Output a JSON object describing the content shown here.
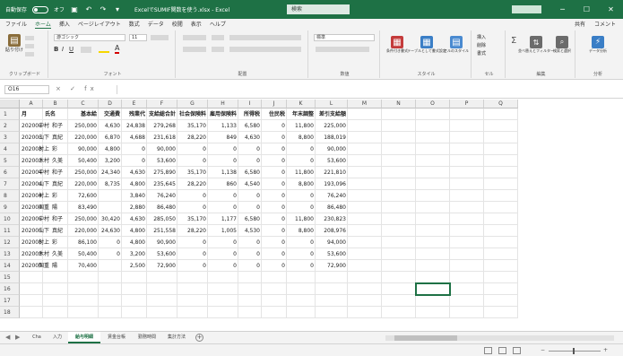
{
  "titlebar": {
    "autosave_label": "自動保存",
    "autosave_state": "オフ",
    "title": "ExcelでSUMIF関数を使う.xlsx - Excel",
    "search_placeholder": "検索",
    "minimize": "─",
    "restore": "☐",
    "close": "✕"
  },
  "menu": {
    "tabs": [
      "ファイル",
      "ホーム",
      "挿入",
      "ページレイアウト",
      "数式",
      "データ",
      "校閲",
      "表示",
      "ヘルプ"
    ],
    "active": "ホーム",
    "share": "共有",
    "comments": "コメント"
  },
  "ribbon": {
    "groups": [
      "クリップボード",
      "フォント",
      "配置",
      "数値",
      "スタイル",
      "セル",
      "編集",
      "分析"
    ],
    "font_name": "游ゴシック",
    "font_size": "11",
    "number_format": "標準",
    "paste_label": "貼り付け",
    "cond_format": "条件付き書式",
    "table_format": "テーブルとして書式設定",
    "cell_style": "セルのスタイル",
    "insert": "挿入",
    "delete": "削除",
    "format": "書式",
    "sort_filter": "並べ替えとフィルター",
    "find_select": "検索と選択",
    "analyze": "データ分析"
  },
  "formulabar": {
    "namebox": "O16",
    "fx_symbols": "× ✓ fx",
    "value": ""
  },
  "grid": {
    "columns": [
      "A",
      "B",
      "C",
      "D",
      "E",
      "F",
      "G",
      "H",
      "I",
      "J",
      "K",
      "L",
      "M",
      "N",
      "O",
      "P",
      "Q"
    ],
    "rows": [
      "1",
      "2",
      "3",
      "4",
      "5",
      "6",
      "7",
      "8",
      "9",
      "10",
      "11",
      "12",
      "13",
      "14",
      "15",
      "16",
      "17",
      "18"
    ],
    "header": [
      "月",
      "氏名",
      "基本給",
      "交通費",
      "残業代",
      "支給総合計",
      "社会保険料",
      "雇用保険料",
      "所得税",
      "住民税",
      "年末調整",
      "差引支給額"
    ],
    "data": [
      [
        "202003",
        "中村",
        "和子",
        "250,000",
        "4,630",
        "24,838",
        "279,268",
        "35,170",
        "1,133",
        "6,580",
        "0",
        "11,800",
        "225,000"
      ],
      [
        "202003",
        "山下",
        "真紀",
        "220,000",
        "6,870",
        "4,688",
        "231,618",
        "28,220",
        "849",
        "4,630",
        "0",
        "8,800",
        "188,019"
      ],
      [
        "202003",
        "村上",
        "彩",
        "90,000",
        "4,800",
        "0",
        "90,000",
        "0",
        "0",
        "0",
        "0",
        "0",
        "90,000"
      ],
      [
        "202003",
        "木村",
        "久美",
        "50,400",
        "3,200",
        "0",
        "53,600",
        "0",
        "0",
        "0",
        "0",
        "0",
        "53,600"
      ],
      [
        "202004",
        "中村",
        "和子",
        "250,000",
        "24,340",
        "4,630",
        "275,890",
        "35,170",
        "1,138",
        "6,580",
        "0",
        "11,800",
        "221,810"
      ],
      [
        "202004",
        "山下",
        "真紀",
        "220,000",
        "8,735",
        "4,800",
        "235,645",
        "28,220",
        "860",
        "4,540",
        "0",
        "8,800",
        "193,096"
      ],
      [
        "202004",
        "村上",
        "彩",
        "72,600",
        "",
        "3,840",
        "76,240",
        "0",
        "0",
        "0",
        "0",
        "0",
        "76,240"
      ],
      [
        "202004",
        "国重",
        "陽",
        "83,490",
        "",
        "2,880",
        "86,480",
        "0",
        "0",
        "0",
        "0",
        "0",
        "86,480"
      ],
      [
        "202005",
        "中村",
        "和子",
        "250,000",
        "30,420",
        "4,630",
        "285,050",
        "35,170",
        "1,177",
        "6,580",
        "0",
        "11,800",
        "230,823"
      ],
      [
        "202005",
        "山下",
        "真紀",
        "220,000",
        "24,630",
        "4,800",
        "251,558",
        "28,220",
        "1,005",
        "4,530",
        "0",
        "8,800",
        "208,976"
      ],
      [
        "202005",
        "村上",
        "彩",
        "86,100",
        "0",
        "4,800",
        "90,900",
        "0",
        "0",
        "0",
        "0",
        "0",
        "94,000"
      ],
      [
        "202005",
        "木村",
        "久美",
        "50,400",
        "0",
        "3,200",
        "53,600",
        "0",
        "0",
        "0",
        "0",
        "0",
        "53,600"
      ],
      [
        "202005",
        "国重",
        "陽",
        "70,400",
        "",
        "2,500",
        "72,900",
        "0",
        "0",
        "0",
        "0",
        "0",
        "72,900"
      ]
    ]
  },
  "sheets": {
    "tabs": [
      "Cha",
      "入力",
      "給与明細",
      "賃金台帳",
      "勤務時間",
      "集計方法"
    ],
    "active": "給与明細",
    "add": "+"
  },
  "status": {
    "zoom": "100%",
    "minus": "−",
    "plus": "+"
  },
  "colors": {
    "brand": "#1e7145",
    "ribbon_bg": "#f3f3f3"
  }
}
